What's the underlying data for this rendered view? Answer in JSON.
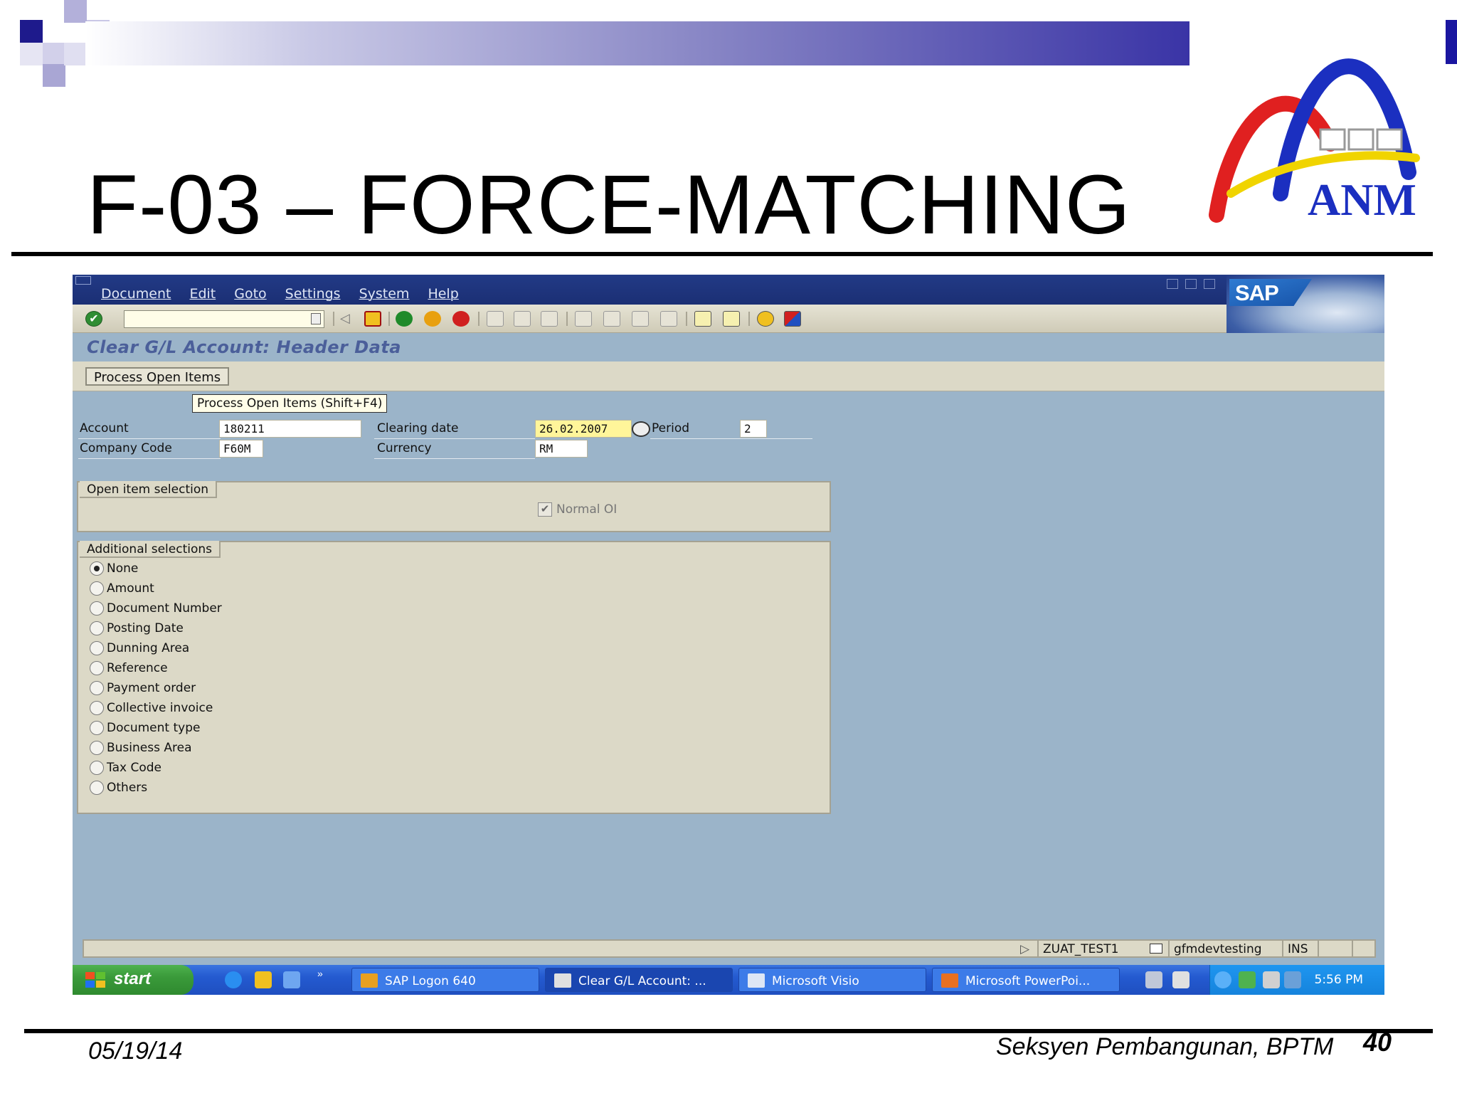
{
  "slide": {
    "title": "F-03 – FORCE-MATCHING",
    "footer_date": "05/19/14",
    "footer_org": "Seksyen Pembangunan, BPTM",
    "page_number": "40",
    "logo_text": "ANM"
  },
  "sap": {
    "menu": [
      "Document",
      "Edit",
      "Goto",
      "Settings",
      "System",
      "Help"
    ],
    "logo_text": "SAP",
    "command_field_value": "",
    "screen_title": "Clear G/L Account: Header Data",
    "app_button": "Process Open Items",
    "tooltip": "Process Open Items   (Shift+F4)",
    "fields": {
      "account_label": "Account",
      "account_value": "180211",
      "company_code_label": "Company Code",
      "company_code_value": "F60M",
      "clearing_date_label": "Clearing date",
      "clearing_date_value": "26.02.2007",
      "period_label": "Period",
      "period_value": "2",
      "currency_label": "Currency",
      "currency_value": "RM"
    },
    "open_item_selection": {
      "title": "Open item selection",
      "normal_oi_label": "Normal OI",
      "normal_oi_checked": true
    },
    "additional_selections": {
      "title": "Additional selections",
      "selected": "None",
      "options": [
        "None",
        "Amount",
        "Document Number",
        "Posting Date",
        "Dunning Area",
        "Reference",
        "Payment order",
        "Collective invoice",
        "Document type",
        "Business Area",
        "Tax Code",
        "Others"
      ]
    },
    "status_bar": {
      "system": "ZUAT_TEST1",
      "server": "gfmdevtesting",
      "mode": "INS"
    }
  },
  "taskbar": {
    "start_label": "start",
    "tasks": [
      "SAP Logon 640",
      "Clear G/L Account: ...",
      "Microsoft Visio",
      "Microsoft PowerPoi..."
    ],
    "active_task": "Clear G/L Account: ...",
    "clock": "5:56 PM"
  },
  "colors": {
    "sap_background": "#9bb4c9",
    "sap_menubar": "#223a86",
    "sap_panel": "#dcd9c7",
    "input_yellow": "#fff59a",
    "taskbar_blue": "#245ad0",
    "start_green": "#3a9a3a"
  }
}
